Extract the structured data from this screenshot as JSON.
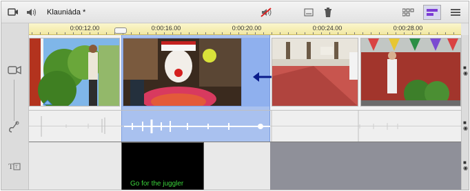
{
  "toolbar": {
    "project_title": "Klauniáda *",
    "icons": [
      "storyboard-icon",
      "audio-mixer-icon",
      "mute-audio-icon",
      "subtitle-icon",
      "trash-icon",
      "grid-view-icon",
      "timeline-view-icon",
      "text-view-icon"
    ]
  },
  "ruler": {
    "labels": [
      "0:00:12.00",
      "0:00:16.00",
      "0:00:20.00",
      "0:00:24.00",
      "0:00:28.00"
    ]
  },
  "title_track": {
    "title_clip_text": "Go for the juggler"
  },
  "colors": {
    "selection": "#a9c1ef",
    "ruler_bg": "#f2e8a3",
    "title_text": "#3bd43b",
    "active_view": "#7c3bd4"
  }
}
